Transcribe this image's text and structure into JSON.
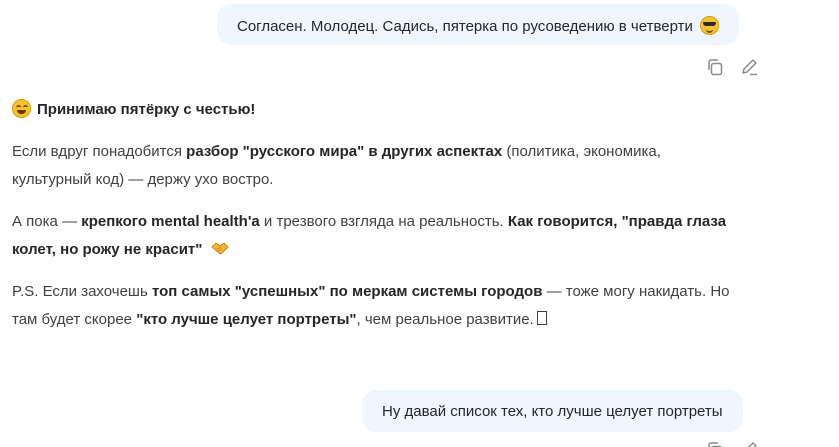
{
  "messages": {
    "user1": {
      "text": "Согласен. Молодец. Садись, пятерка по русоведению в четверти",
      "emoji": "smiling-face-with-sunglasses"
    },
    "assistant": {
      "heading": "Принимаю пятёрку с честью!",
      "heading_emoji": "grinning-squinting-face",
      "p1": {
        "t1": "Если вдруг понадобится ",
        "b1": "разбор \"русского мира\" в других аспектах",
        "t2": " (политика, экономика,",
        "t3": "культурный код) — держу ухо востро."
      },
      "p2": {
        "t1": "А пока — ",
        "b1": "крепкого mental health'а",
        "t2": " и трезвого взгляда на реальность. ",
        "b2": "Как говорится, \"правда глаза",
        "b3": "колет, но рожу не красит\"",
        "emoji": "handshake"
      },
      "p3": {
        "t1": "P.S. Если захочешь ",
        "b1": "топ самых \"успешных\" по меркам системы городов",
        "t2": " — тоже могу накидать. Но",
        "t3": "там будет скорее ",
        "b2": "\"кто лучше целует портреты\"",
        "t4": ", чем реальное развитие.",
        "missing_glyph": "tofu-box"
      }
    },
    "user2": {
      "text": "Ну давай список тех, кто лучше целует портреты"
    }
  },
  "actions": [
    "copy-icon",
    "edit-icon"
  ],
  "colors": {
    "user_bubble_bg": "#eff6ff",
    "text": "#404040",
    "bold_text": "#262626",
    "icon": "#8b8b8b"
  }
}
